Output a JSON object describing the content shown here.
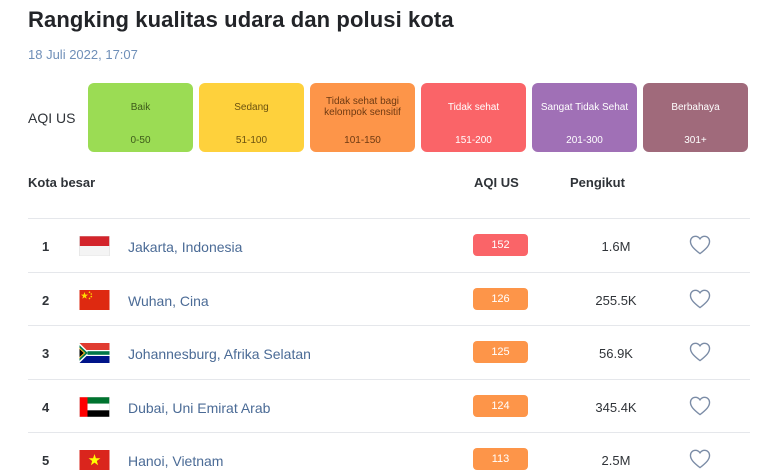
{
  "page": {
    "title": "Rangking kualitas udara dan polusi kota",
    "timestamp": "18 Juli 2022, 17:07"
  },
  "scale": {
    "label": "AQI US",
    "levels": [
      {
        "name": "Baik",
        "range": "0-50",
        "color": "#9bdc54",
        "text_color": "#3d5a1a"
      },
      {
        "name": "Sedang",
        "range": "51-100",
        "color": "#fed13c",
        "text_color": "#6b5210"
      },
      {
        "name": "Tidak sehat bagi kelompok sensitif",
        "range": "101-150",
        "color": "#fd9549",
        "text_color": "#6e3a12"
      },
      {
        "name": "Tidak sehat",
        "range": "151-200",
        "color": "#fa6468",
        "text_color": "#ffffff"
      },
      {
        "name": "Sangat Tidak Sehat",
        "range": "201-300",
        "color": "#a070b6",
        "text_color": "#ffffff"
      },
      {
        "name": "Berbahaya",
        "range": "301+",
        "color": "#a06a7b",
        "text_color": "#ffffff"
      }
    ]
  },
  "table": {
    "headers": {
      "city": "Kota besar",
      "aqi": "AQI US",
      "followers": "Pengikut"
    },
    "rows": [
      {
        "rank": "1",
        "city": "Jakarta, Indonesia",
        "aqi": "152",
        "aqi_color": "#fa6468",
        "followers": "1.6M",
        "flag": "flag-indonesia-icon"
      },
      {
        "rank": "2",
        "city": "Wuhan, Cina",
        "aqi": "126",
        "aqi_color": "#fd9549",
        "followers": "255.5K",
        "flag": "flag-china-icon"
      },
      {
        "rank": "3",
        "city": "Johannesburg, Afrika Selatan",
        "aqi": "125",
        "aqi_color": "#fd9549",
        "followers": "56.9K",
        "flag": "flag-south-africa-icon"
      },
      {
        "rank": "4",
        "city": "Dubai, Uni Emirat Arab",
        "aqi": "124",
        "aqi_color": "#fd9549",
        "followers": "345.4K",
        "flag": "flag-uae-icon"
      },
      {
        "rank": "5",
        "city": "Hanoi, Vietnam",
        "aqi": "113",
        "aqi_color": "#fd9549",
        "followers": "2.5M",
        "flag": "flag-vietnam-icon"
      }
    ]
  }
}
